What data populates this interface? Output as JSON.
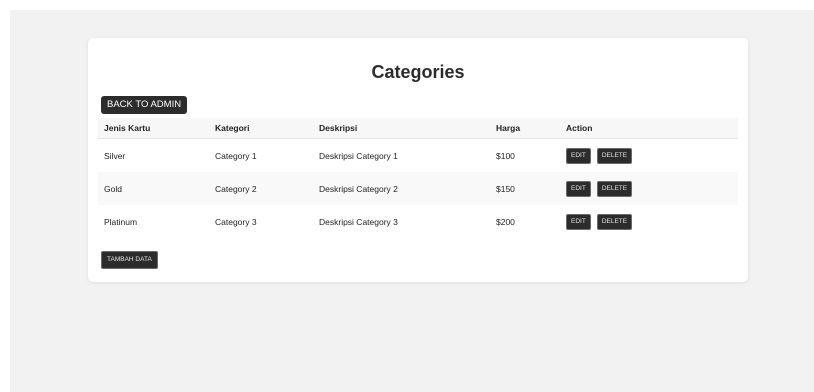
{
  "page": {
    "title": "Categories",
    "back_label": "BACK TO ADMIN",
    "add_label": "TAMBAH DATA"
  },
  "table": {
    "headers": {
      "jenis": "Jenis Kartu",
      "kategori": "Kategori",
      "deskripsi": "Deskripsi",
      "harga": "Harga",
      "action": "Action"
    },
    "rows": [
      {
        "jenis": "Silver",
        "kategori": "Category 1",
        "deskripsi": "Deskripsi Category 1",
        "harga": "$100",
        "edit": "EDIT",
        "delete": "DELETE"
      },
      {
        "jenis": "Gold",
        "kategori": "Category 2",
        "deskripsi": "Deskripsi Category 2",
        "harga": "$150",
        "edit": "EDIT",
        "delete": "DELETE"
      },
      {
        "jenis": "Platinum",
        "kategori": "Category 3",
        "deskripsi": "Deskripsi Category 3",
        "harga": "$200",
        "edit": "EDIT",
        "delete": "DELETE"
      }
    ]
  }
}
